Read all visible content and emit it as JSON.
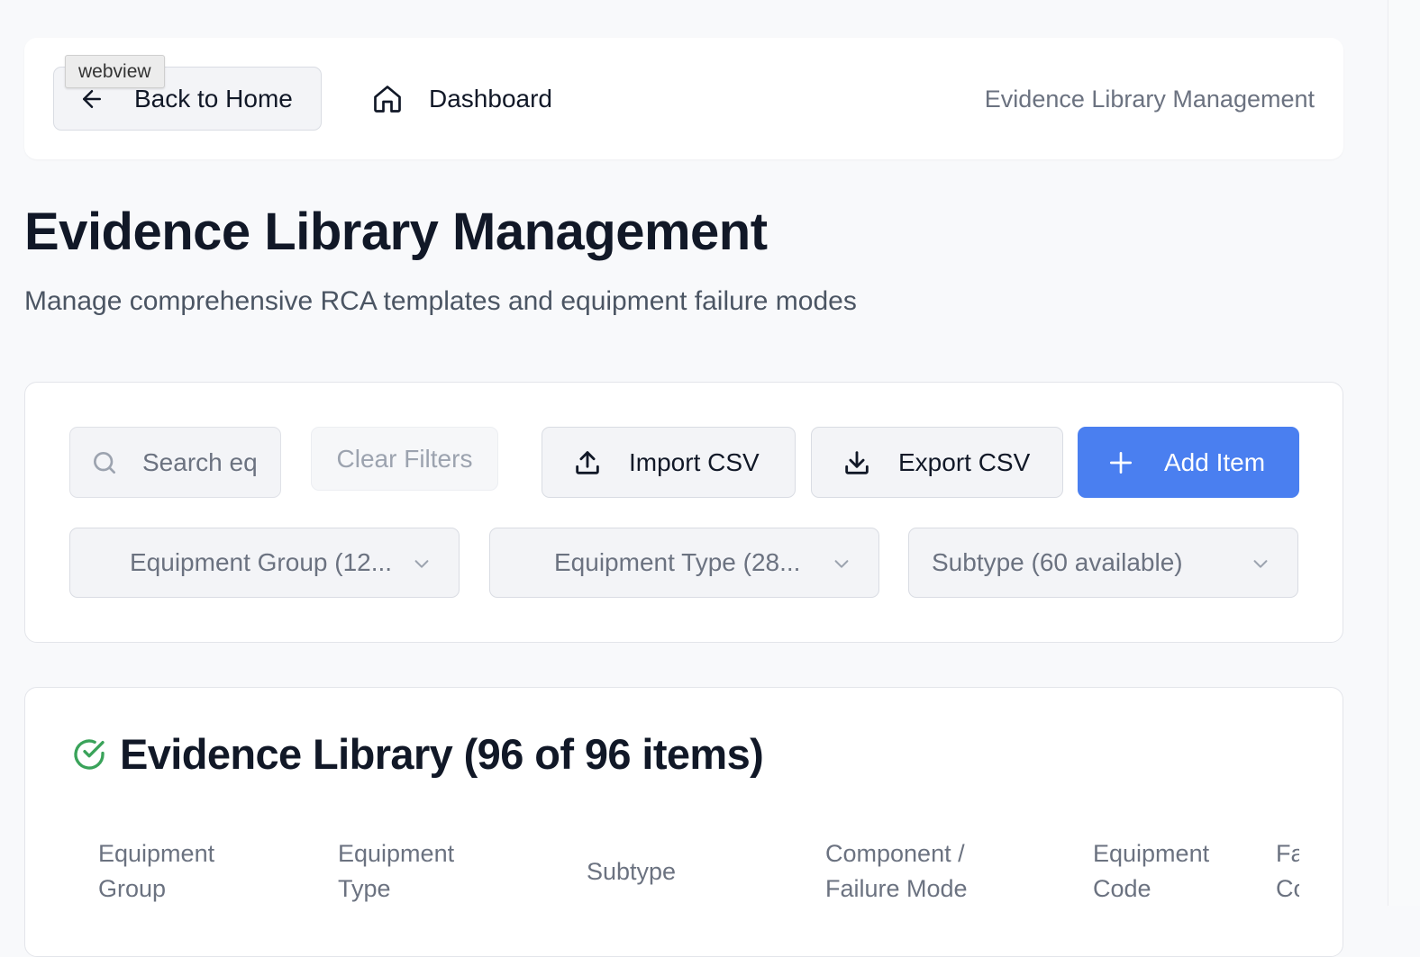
{
  "nav": {
    "back_label": "Back to Home",
    "tooltip": "webview",
    "dashboard_label": "Dashboard",
    "current_page": "Evidence Library Management"
  },
  "header": {
    "title": "Evidence Library Management",
    "subtitle": "Manage comprehensive RCA templates and equipment failure modes"
  },
  "toolbar": {
    "search_placeholder": "Search eq",
    "clear_label": "Clear Filters",
    "import_label": "Import CSV",
    "export_label": "Export CSV",
    "add_label": "Add Item",
    "accent_color": "#4a7ff0"
  },
  "filters": {
    "equipment_group": "Equipment Group (12...",
    "equipment_type": "Equipment Type (28...",
    "subtype": "Subtype (60 available)"
  },
  "library": {
    "title": "Evidence Library (96 of 96 items)",
    "status_icon": "check-circle-icon",
    "status_color": "#3aa35a",
    "columns": [
      {
        "line1": "Equipment",
        "line2": "Group"
      },
      {
        "line1": "Equipment",
        "line2": "Type"
      },
      {
        "line1": "Subtype",
        "line2": ""
      },
      {
        "line1": "Component /",
        "line2": "Failure Mode"
      },
      {
        "line1": "Equipment",
        "line2": "Code"
      },
      {
        "line1": "Fa",
        "line2": "Co"
      }
    ]
  }
}
